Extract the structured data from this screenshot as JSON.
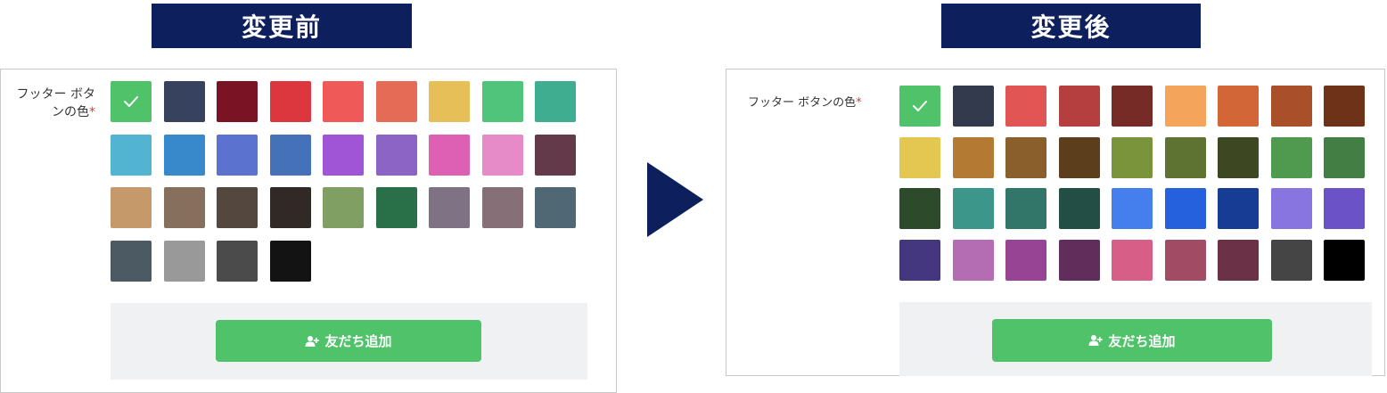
{
  "before": {
    "banner": "変更前",
    "label": "フッター ボタンの色",
    "required_mark": "*",
    "selected_index": 0,
    "button_label": "友だち追加",
    "button_icon": "add-user-icon",
    "colors": [
      "#4fc26a",
      "#37435e",
      "#7a1324",
      "#dc363f",
      "#ef5958",
      "#e56b56",
      "#e7bf58",
      "#4fc47a",
      "#3fae90",
      "#52b4d1",
      "#3789cb",
      "#5b72cf",
      "#4471b7",
      "#a054d6",
      "#8b64c6",
      "#dd60b5",
      "#e68bc7",
      "#623a4a",
      "#c6996b",
      "#86705d",
      "#54473d",
      "#302925",
      "#7f9f63",
      "#297048",
      "#7e7284",
      "#876f78",
      "#506874",
      "#4b5a63",
      "#999999",
      "#4b4b4b",
      "#131313"
    ]
  },
  "after": {
    "banner": "変更後",
    "label": "フッター ボタンの色",
    "required_mark": "*",
    "selected_index": 0,
    "button_label": "友だち追加",
    "button_icon": "add-user-icon",
    "colors": [
      "#4fc26a",
      "#343a4e",
      "#e15554",
      "#b53f3f",
      "#772b27",
      "#f4a45b",
      "#d36637",
      "#a94f29",
      "#6e3219",
      "#e3c751",
      "#b37a33",
      "#8a5f2c",
      "#5c3e1d",
      "#7a943b",
      "#5e7331",
      "#3d4822",
      "#4f9a4f",
      "#437f44",
      "#2d4b2b",
      "#3c978a",
      "#317668",
      "#234e46",
      "#457fee",
      "#2560dd",
      "#163c94",
      "#8875e0",
      "#6b52c7",
      "#44377f",
      "#b46db3",
      "#984495",
      "#612d5b",
      "#d65e87",
      "#a24b64",
      "#6b3147",
      "#454545",
      "#000000"
    ]
  }
}
